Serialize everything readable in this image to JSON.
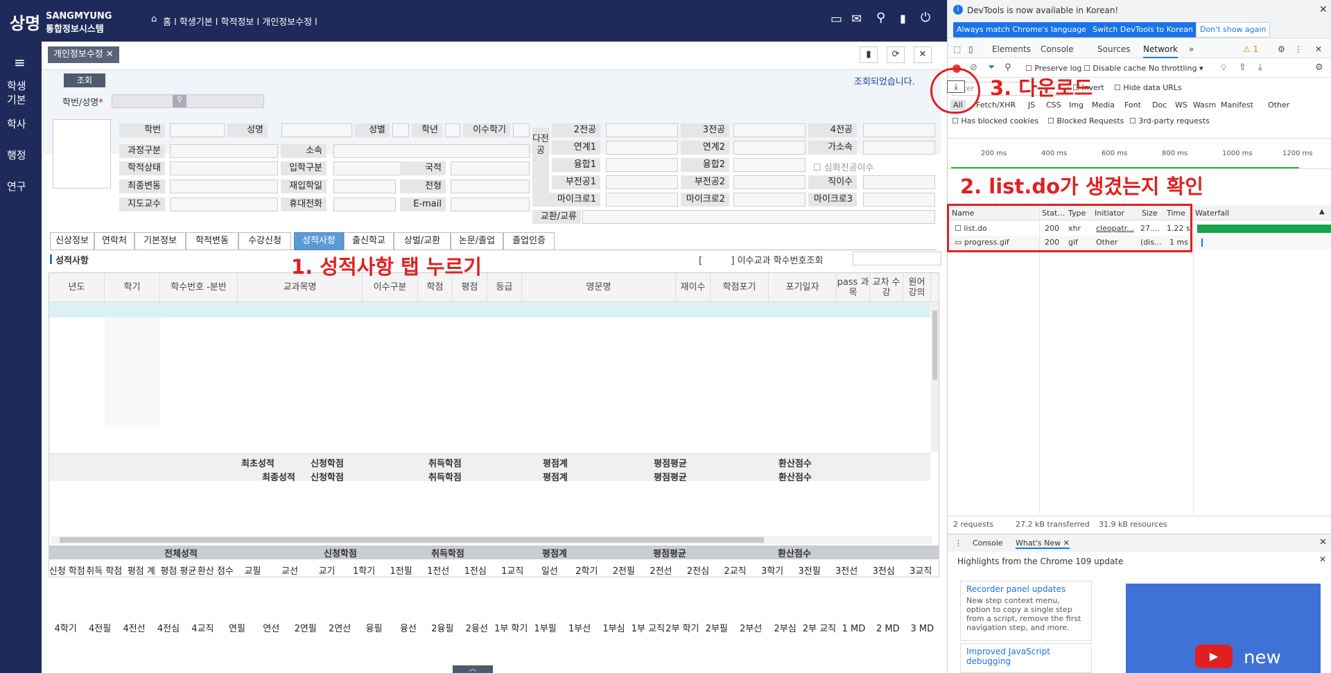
{
  "top": {
    "logo_kr": "상명",
    "logo_en": "SANGMYUNG",
    "logo_sub": "통합정보시스템",
    "breadcrumb": "홈 l 학생기본 l 학적정보 l 개인정보수정 l"
  },
  "sidenav": [
    "학생기본",
    "학사",
    "행정",
    "연구"
  ],
  "page_tab": "개인정보수정",
  "search": {
    "button": "조회",
    "field_label": "학번/성명",
    "status": "조회되었습니다."
  },
  "form": {
    "row1": [
      "학번",
      "성명",
      "성별",
      "학년",
      "이수학기"
    ],
    "major_group": "다전공",
    "majors": [
      "2전공",
      "3전공",
      "4전공",
      "연계1",
      "연계2",
      "가소속",
      "융합1",
      "융합2",
      "부전공1",
      "부전공2",
      "마이크로1",
      "마이크로2",
      "마이크로3"
    ],
    "deep_major": "심화전공이수",
    "leave_count": "직이수",
    "exchange": "교환/교류",
    "left": [
      "과정구분",
      "학적상태",
      "최종변동",
      "지도교수"
    ],
    "mid": [
      "소속",
      "입학구분",
      "재입학일",
      "휴대전화"
    ],
    "right": [
      "국적",
      "전형",
      "E-mail"
    ]
  },
  "tabs": [
    "신상정보",
    "연락처",
    "기본정보",
    "학적변동",
    "수강신청",
    "성적사항",
    "출신학교",
    "상벌/교환",
    "논문/졸업",
    "졸업인증"
  ],
  "active_tab": "성적사항",
  "section": {
    "title": "성적사항",
    "checkbox_label": "이수교과 학수번호조회"
  },
  "grid_headers": [
    "년도",
    "학기",
    "학수번호 -분반",
    "교과목명",
    "이수구분",
    "학점",
    "평점",
    "등급",
    "영문명",
    "재이수",
    "학점포기",
    "포기일자",
    "pass 과목",
    "교차 수강",
    "원어 강의"
  ],
  "summary": {
    "first": "최초성적",
    "final": "최종성적",
    "apply": "신청학점",
    "earned": "취득학점",
    "sum": "평점계",
    "avg": "평점평균",
    "conv": "환산점수"
  },
  "total": {
    "title": "전체성적",
    "apply": "신청학점",
    "earned": "취득학점",
    "sum": "평점계",
    "avg": "평점평균",
    "conv": "환산점수"
  },
  "groups1": [
    "신청 학점",
    "취득 학점",
    "평점 계",
    "평점 평균",
    "환산 점수",
    "교필",
    "교선",
    "교기",
    "1학기",
    "1전필",
    "1전선",
    "1전심",
    "1교직",
    "일선",
    "2학기",
    "2전필",
    "2전선",
    "2전심",
    "2교직",
    "3학기",
    "3전필",
    "3전선",
    "3전심",
    "3교직"
  ],
  "groups2": [
    "4학기",
    "4전필",
    "4전선",
    "4전심",
    "4교직",
    "연필",
    "연선",
    "2연필",
    "2연선",
    "융필",
    "융선",
    "2융필",
    "2융선",
    "1부 학기",
    "1부필",
    "1부선",
    "1부심",
    "1부 교직",
    "2부 학기",
    "2부필",
    "2부선",
    "2부심",
    "2부 교직",
    "1 MD",
    "2 MD",
    "3 MD"
  ],
  "devtools": {
    "info": "DevTools is now available in Korean!",
    "btn1": "Always match Chrome's language",
    "btn2": "Switch DevTools to Korean",
    "btn3": "Don't show again",
    "tabs": [
      "Elements",
      "Console",
      "Sources",
      "Network"
    ],
    "active": "Network",
    "issues": "1",
    "preserve": "Preserve log",
    "disable_cache": "Disable cache",
    "throttle": "No throttling",
    "filter": "Filter",
    "invert": "Invert",
    "hide_data": "Hide data URLs",
    "types": [
      "All",
      "Fetch/XHR",
      "JS",
      "CSS",
      "Img",
      "Media",
      "Font",
      "Doc",
      "WS",
      "Wasm",
      "Manifest",
      "Other"
    ],
    "blocked_cookies": "Has blocked cookies",
    "blocked_req": "Blocked Requests",
    "third": "3rd-party requests",
    "ticks": [
      "200 ms",
      "400 ms",
      "600 ms",
      "800 ms",
      "1000 ms",
      "1200 ms"
    ],
    "cols": [
      "Name",
      "Stat...",
      "Type",
      "Initiator",
      "Size",
      "Time",
      "Waterfall"
    ],
    "rows": [
      {
        "name": "list.do",
        "status": "200",
        "type": "xhr",
        "init": "cleopatr...",
        "size": "27....",
        "time": "1.22 s"
      },
      {
        "name": "progress.gif",
        "status": "200",
        "type": "gif",
        "init": "Other",
        "size": "(dis...",
        "time": "1 ms"
      }
    ],
    "footer": {
      "req": "2 requests",
      "transferred": "27.2 kB transferred",
      "resources": "31.9 kB resources"
    },
    "drawer_tabs": [
      "Console",
      "What's New"
    ],
    "highlights": "Highlights from the Chrome 109 update",
    "card1_title": "Recorder panel updates",
    "card1_body": "New step context menu, option to copy a single step from a script, remove the first navigation step, and more.",
    "card2_title": "Improved JavaScript debugging",
    "video_text": "new"
  },
  "annotations": {
    "a1": "1. 성적사항 탭 누르기",
    "a2": "2. list.do가 생겼는지 확인",
    "a3": "3. 다운로드"
  }
}
